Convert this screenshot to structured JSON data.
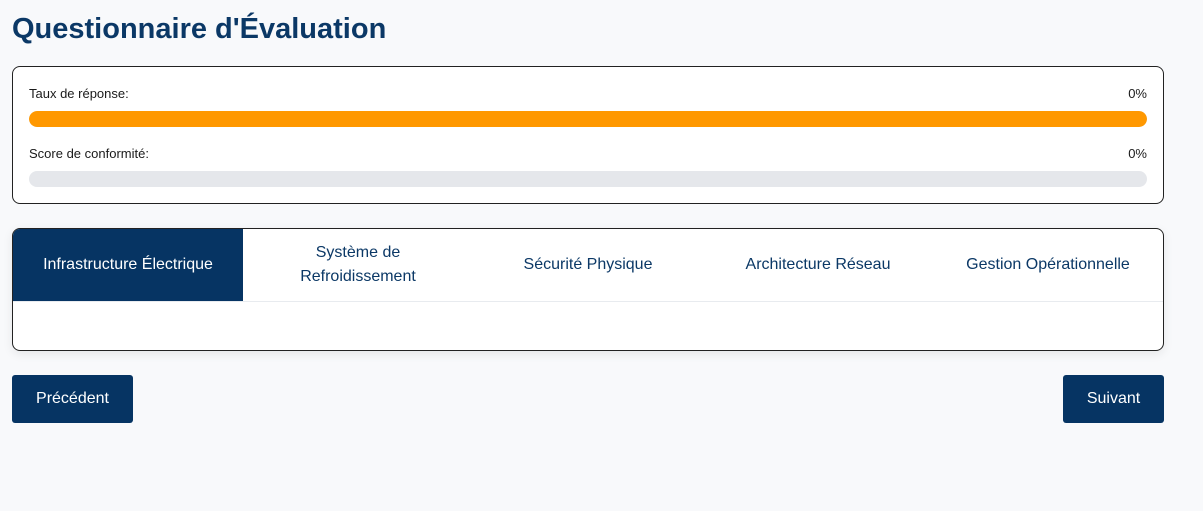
{
  "page_title": "Questionnaire d'Évaluation",
  "progress": {
    "response_rate": {
      "label": "Taux de réponse:",
      "value_text": "0%",
      "fill_fraction": 1.0,
      "color": "#ff9800"
    },
    "compliance_score": {
      "label": "Score de conformité:",
      "value_text": "0%",
      "fill_fraction": 0.0,
      "color": "#3b82f6"
    }
  },
  "tabs": [
    {
      "label": "Infrastructure Électrique",
      "active": true
    },
    {
      "label": "Système de Refroidissement",
      "active": false
    },
    {
      "label": "Sécurité Physique",
      "active": false
    },
    {
      "label": "Architecture Réseau",
      "active": false
    },
    {
      "label": "Gestion Opérationnelle",
      "active": false
    }
  ],
  "navigation": {
    "previous_label": "Précédent",
    "next_label": "Suivant"
  },
  "colors": {
    "primary": "#063463",
    "title": "#0b3866",
    "accent_orange": "#ff9800",
    "track": "#e5e7eb"
  }
}
